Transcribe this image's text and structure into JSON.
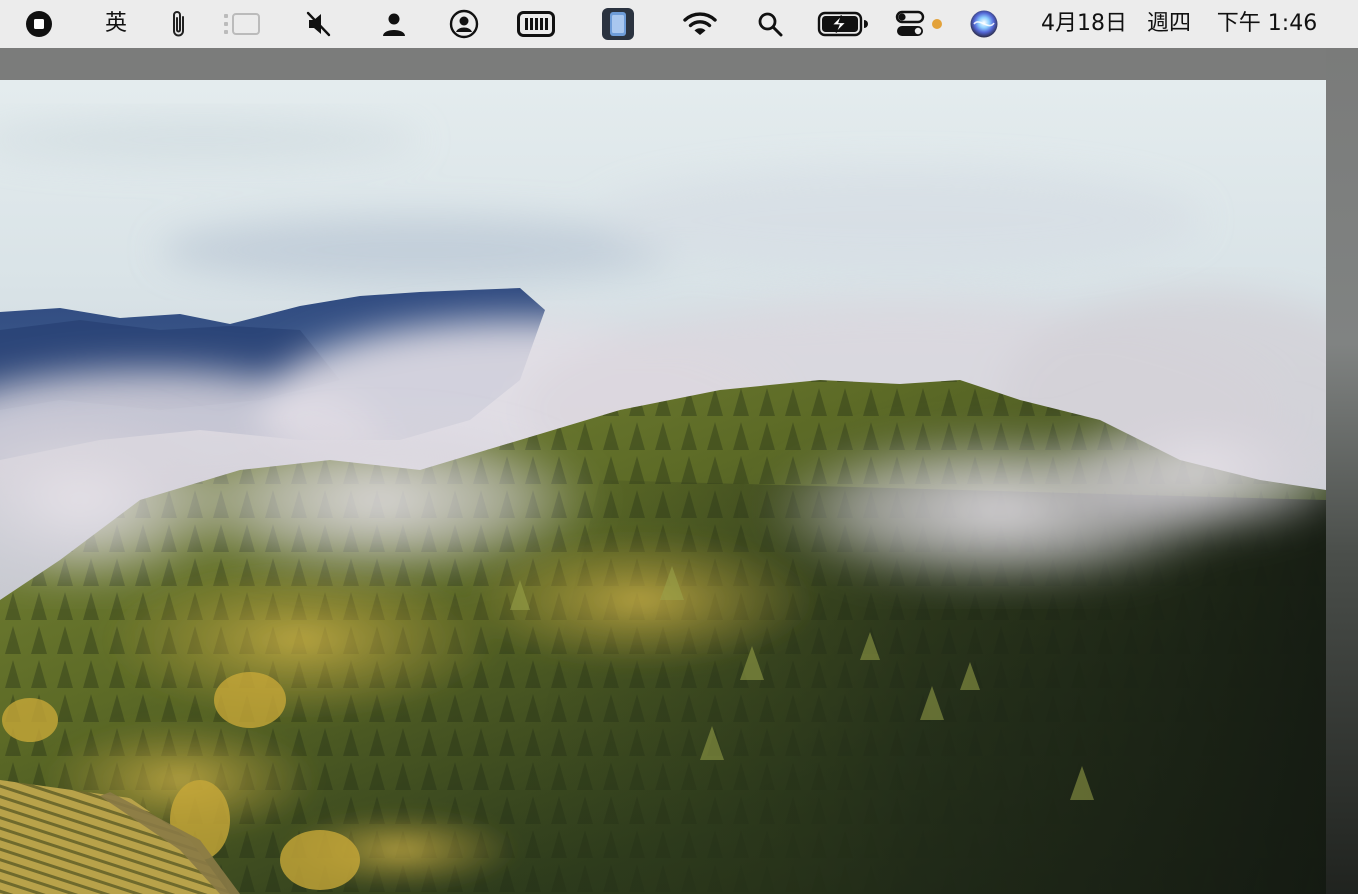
{
  "menubar": {
    "input_method_label": "英",
    "clock": {
      "date": "4月18日",
      "weekday": "週四",
      "time": "下午 1:46"
    },
    "status_icons": [
      "stop-recording-icon",
      "input-method-icon",
      "paperclip-icon",
      "stage-manager-icon",
      "muted-speaker-icon",
      "user-icon",
      "account-circle-icon",
      "memory-icon",
      "phone-app-icon",
      "wifi-icon",
      "search-icon",
      "battery-charging-icon",
      "control-center-icon",
      "siri-icon"
    ],
    "accent_dot_color": "#e3a23a"
  },
  "desktop": {
    "wallpaper": "misty-forest-hills"
  }
}
